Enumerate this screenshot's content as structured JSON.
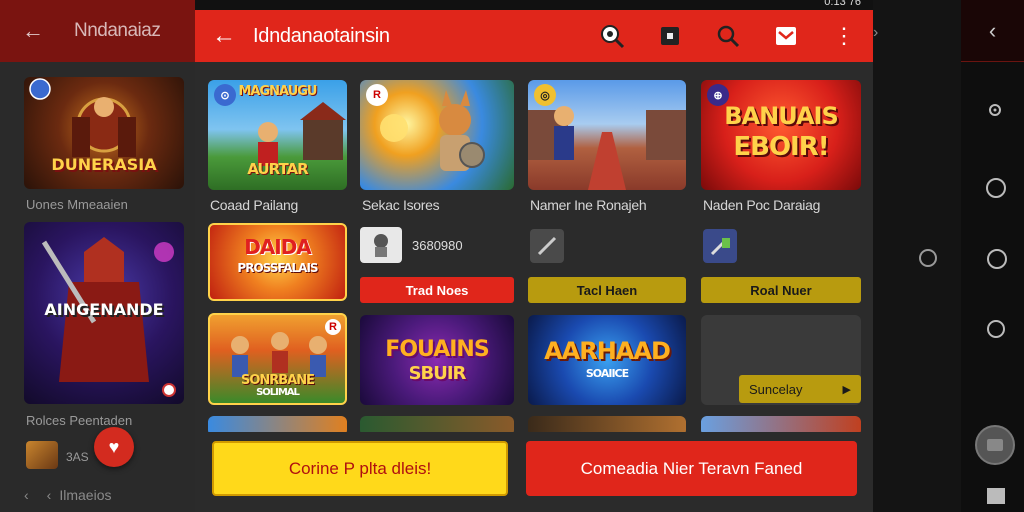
{
  "status": {
    "time": "0:13 76"
  },
  "background_app": {
    "title": "Nndanaiaz",
    "cards": [
      {
        "caption": "Uones Mmeaaien",
        "banner": "DUNERASIA"
      },
      {
        "caption": "Rolces Peentaden",
        "banner": "AINGENANDE"
      }
    ],
    "mini_label": "3AS",
    "bottom_label": "Ilmaeios"
  },
  "appbar": {
    "title": "Idndanaotainsin",
    "icons": [
      "back-arrow-icon",
      "search-icon",
      "dark-tile-icon",
      "magnifier-icon",
      "inbox-icon",
      "more-vert-icon"
    ]
  },
  "games_row1": [
    {
      "caption": "Coaad Pailang",
      "banner_top": "MAGNAUGU",
      "banner_bottom": "AURTAR",
      "badge": "⊙"
    },
    {
      "caption": "Sekac Isores",
      "badge": "R"
    },
    {
      "caption": "Namer Ine Ronajeh",
      "badge": "◎"
    },
    {
      "caption": "Naden Poc Daraiag",
      "banner_top": "BANUAIS",
      "banner_bottom": "EBOIR!",
      "badge": "⊕"
    }
  ],
  "games_row2": [
    {
      "banner_top": "DAIDA",
      "banner_bottom": "PROSSFALAIS"
    },
    {
      "info": "3680980",
      "pill": "Trad Noes"
    },
    {
      "pill": "Tacl Haen"
    },
    {
      "pill": "Roal Nuer"
    }
  ],
  "games_row3": [
    {
      "banner_top": "SONRBANE",
      "banner_bottom": "SOLIMAL"
    },
    {
      "banner_top": "FOUAINS",
      "banner_bottom": "SBUIR"
    },
    {
      "banner_top": "AARHAAD",
      "banner_bottom": "SOAIICE"
    },
    {
      "button": "Suncelay"
    }
  ],
  "actions": {
    "primary": "Corine P plta dleis!",
    "secondary": "Comeadia Nier Teravn Faned"
  },
  "colors": {
    "accent": "#e0261b",
    "yellow": "#ffd91a",
    "olive": "#b89b0f"
  }
}
